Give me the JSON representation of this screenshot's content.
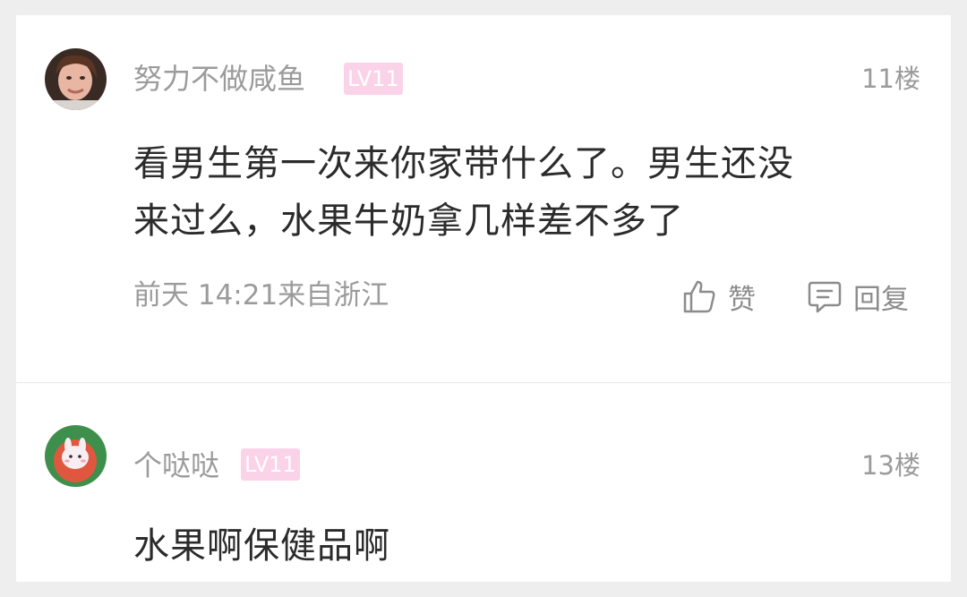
{
  "comments": [
    {
      "username": "努力不做咸鱼",
      "level": "LV11",
      "floor": "11楼",
      "content_line1": "看男生第一次来你家带什么了。男生还没",
      "content_line2": "来过么，水果牛奶拿几样差不多了",
      "meta": "前天 14:21来自浙江",
      "like_label": "赞",
      "reply_label": "回复",
      "avatar_icon": "woman-portrait-avatar"
    },
    {
      "username": "个哒哒",
      "level": "LV11",
      "floor": "13楼",
      "content": "水果啊保健品啊",
      "avatar_icon": "bunny-cartoon-avatar"
    }
  ],
  "colors": {
    "background": "#eeeeee",
    "card": "#ffffff",
    "badge": "#fbd3e9",
    "muted_text": "#9b9b9b",
    "body_text": "#2b2b2b"
  }
}
